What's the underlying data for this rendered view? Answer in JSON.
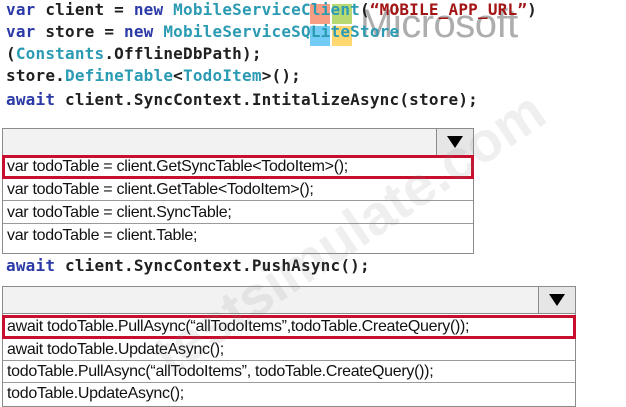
{
  "code_top": {
    "line1": {
      "kw1": "var",
      "t1": " client = ",
      "kw2": "new",
      "sp": " ",
      "ty": "MobileServiceClient",
      "t2": "(",
      "st": "“MOBILE_APP_URL”",
      "t3": ")"
    },
    "line2": {
      "kw1": "var",
      "t1": " store = ",
      "kw2": "new",
      "sp": " ",
      "ty": "MobileServiceSQLiteStore"
    },
    "line3": {
      "t1": "(",
      "ty": "Constants",
      "t2": ".OfflineDbPath);"
    },
    "line4": {
      "t1": "store.",
      "ty1": "DefineTable",
      "t2": "<",
      "ty2": "TodoItem",
      "t3": ">();"
    },
    "line5": {
      "kw": "await",
      "t1": " client.SyncContext.IntitalizeAsync(store);"
    }
  },
  "dropdown1": {
    "options": [
      "var todoTable = client.GetSyncTable<TodoItem>();",
      "var todoTable = client.GetTable<TodoItem>();",
      "var todoTable = client.SyncTable;",
      "var todoTable = client.Table;"
    ],
    "selected_index": 0
  },
  "code_mid": {
    "kw": "await",
    "t1": " client.SyncContext.PushAsync();"
  },
  "dropdown2": {
    "options": [
      "await todoTable.PullAsync(“allTodoItems”,todoTable.CreateQuery());",
      "await todoTable.UpdateAsync();",
      "todoTable.PullAsync(“allTodoItems”, todoTable.CreateQuery());",
      "todoTable.UpdateAsync();"
    ],
    "selected_index": 0
  },
  "watermark": {
    "text": "testsimulate.com",
    "logo_text": "Microsoft"
  },
  "colors": {
    "highlight": "#c8102e",
    "keyword": "#2b3aa6",
    "type": "#2b9bb3",
    "string": "#a31515"
  },
  "icons": {
    "dropdown_arrow": "triangle-down-icon"
  }
}
